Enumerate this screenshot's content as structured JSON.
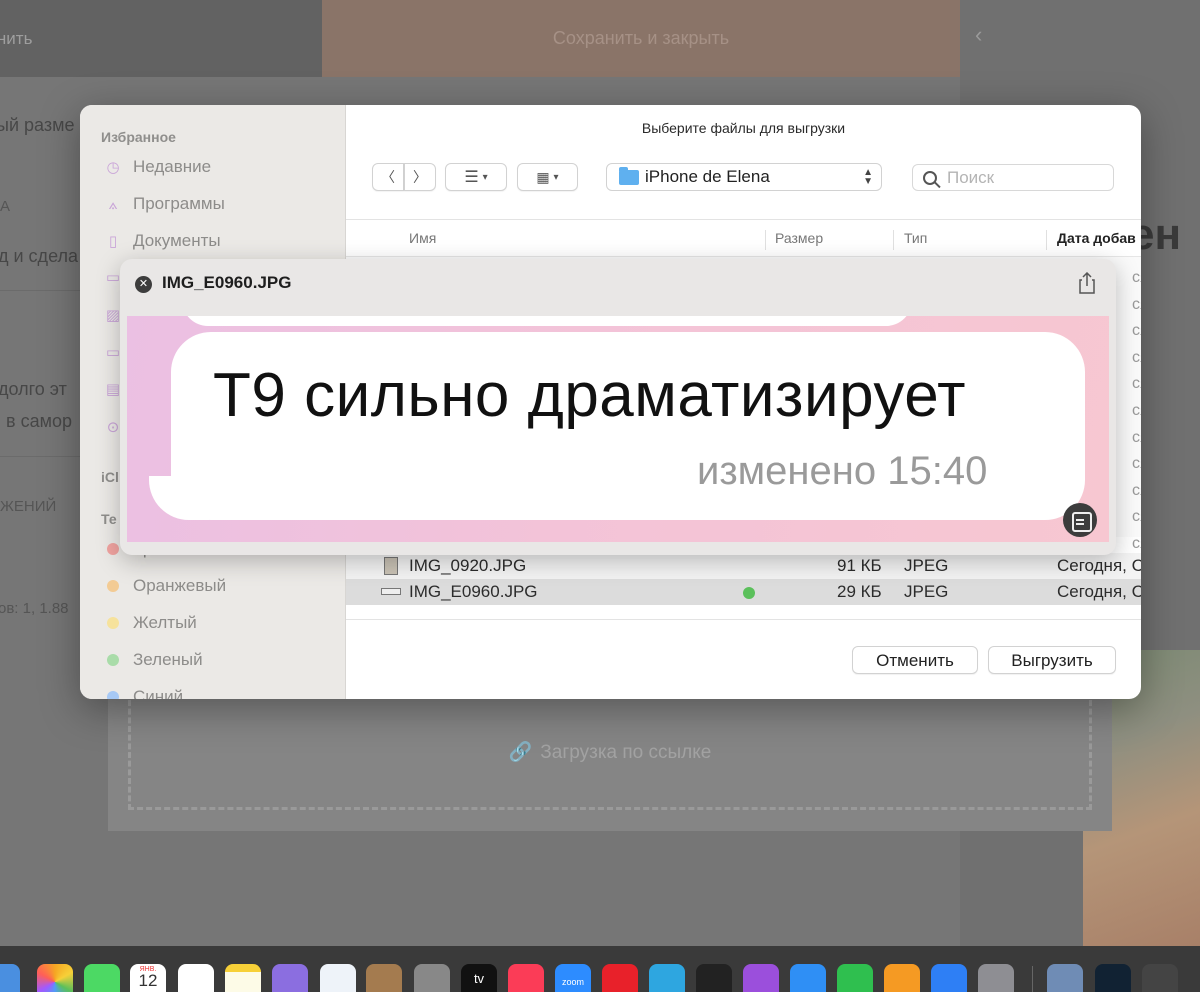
{
  "background": {
    "save_label": "оанить",
    "save_close_label": "Сохранить и закрыть",
    "chevron": "‹",
    "left_text_1": "ый разме",
    "left_text_2": "А",
    "left_text_3": "д и сдела",
    "left_text_4": "долго эт",
    "left_text_5": "в самор",
    "left_text_6": "ЖЕНИЙ",
    "left_text_7": "ов: 1, 1.88",
    "right_big_text": "ен",
    "upload_link_label": "Загрузка по ссылке"
  },
  "dialog": {
    "title": "Выберите файлы для выгрузки",
    "sidebar": {
      "favorites_header": "Избранное",
      "favorites": [
        {
          "label": "Недавние",
          "icon": "clock-icon"
        },
        {
          "label": "Программы",
          "icon": "apps-icon"
        },
        {
          "label": "Документы",
          "icon": "document-icon"
        }
      ],
      "icloud_header": "iCl",
      "tags_header": "Те",
      "tags": [
        {
          "label": "Красный",
          "color": "#ff5f57"
        },
        {
          "label": "Оранжевый",
          "color": "#f5a623"
        },
        {
          "label": "Желтый",
          "color": "#f7d038"
        },
        {
          "label": "Зеленый",
          "color": "#5bc05b"
        },
        {
          "label": "Синий",
          "color": "#4f9cf7"
        }
      ]
    },
    "toolbar": {
      "back_icon": "chevron-left-icon",
      "forward_icon": "chevron-right-icon",
      "list_view_icon": "list-icon",
      "grid_view_icon": "grid-icon",
      "location": "iPhone de Elena",
      "search_placeholder": "Поиск"
    },
    "columns": [
      "Имя",
      "Размер",
      "Тип",
      "Дата добав"
    ],
    "hidden_row_dates": [
      "ся, С",
      "ся, С",
      "ся, С",
      "ся, С",
      "ся, С",
      "ся, С",
      "ся, С",
      "ся, С",
      "ся, С",
      "ся, С",
      "ся, С"
    ],
    "files": [
      {
        "name": "IMG_0920.JPG",
        "size": "91 КБ",
        "type": "JPEG",
        "date": "Сегодня, С",
        "tag": ""
      },
      {
        "name": "IMG_E0960.JPG",
        "size": "29 КБ",
        "type": "JPEG",
        "date": "Сегодня, С",
        "tag": "#5bc05b"
      }
    ],
    "cancel_label": "Отменить",
    "upload_label": "Выгрузить"
  },
  "quicklook": {
    "filename": "IMG_E0960.JPG",
    "message_text": "Т9 сильно драматизирует",
    "message_meta": "изменено 15:40"
  },
  "dock": {
    "calendar_month": "ЯНВ.",
    "calendar_day": "12",
    "tv_label": "tv",
    "zoom_label": "zoom"
  }
}
